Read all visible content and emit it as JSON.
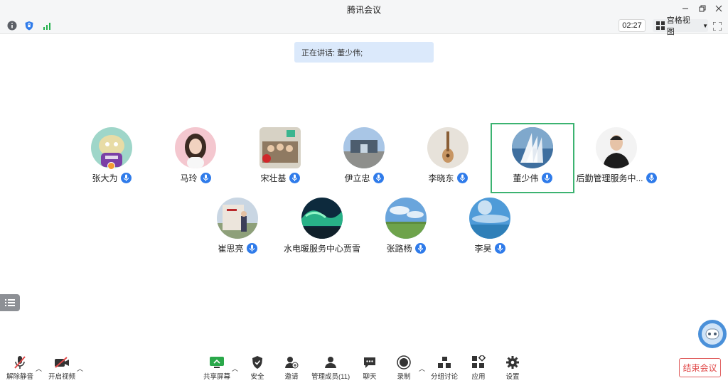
{
  "window": {
    "title": "腾讯会议"
  },
  "status": {
    "timer": "02:27",
    "view_label": "宫格视图"
  },
  "speaking": {
    "text": "正在讲话: 董少伟;"
  },
  "participants": [
    {
      "name": "张大为",
      "avatar": "purple-character"
    },
    {
      "name": "马玲",
      "avatar": "woman-portrait"
    },
    {
      "name": "宋壮基",
      "avatar": "group-photo"
    },
    {
      "name": "伊立忠",
      "avatar": "building-gate"
    },
    {
      "name": "李晓东",
      "avatar": "guitar"
    },
    {
      "name": "董少伟",
      "avatar": "sailboat"
    },
    {
      "name": "后勤管理服务中...",
      "avatar": "man-black-suit"
    },
    {
      "name": "崔思亮",
      "avatar": "stone-monument"
    },
    {
      "name": "水电暖服务中心贾雪",
      "avatar": "aurora"
    },
    {
      "name": "张路杨",
      "avatar": "field-sky"
    },
    {
      "name": "李昊",
      "avatar": "sea-sky"
    }
  ],
  "toolbar": {
    "unmute": "解除静音",
    "start_video": "开启视频",
    "share_screen": "共享屏幕",
    "security": "安全",
    "invite": "邀请",
    "manage_members": "管理成员(11)",
    "chat": "聊天",
    "record": "录制",
    "breakout": "分组讨论",
    "apps": "应用",
    "settings": "设置",
    "end_meeting": "结束会议"
  },
  "colors": {
    "accent": "#2f7bea",
    "active_speaker_frame": "#3cb371",
    "end_button": "#e04848"
  }
}
